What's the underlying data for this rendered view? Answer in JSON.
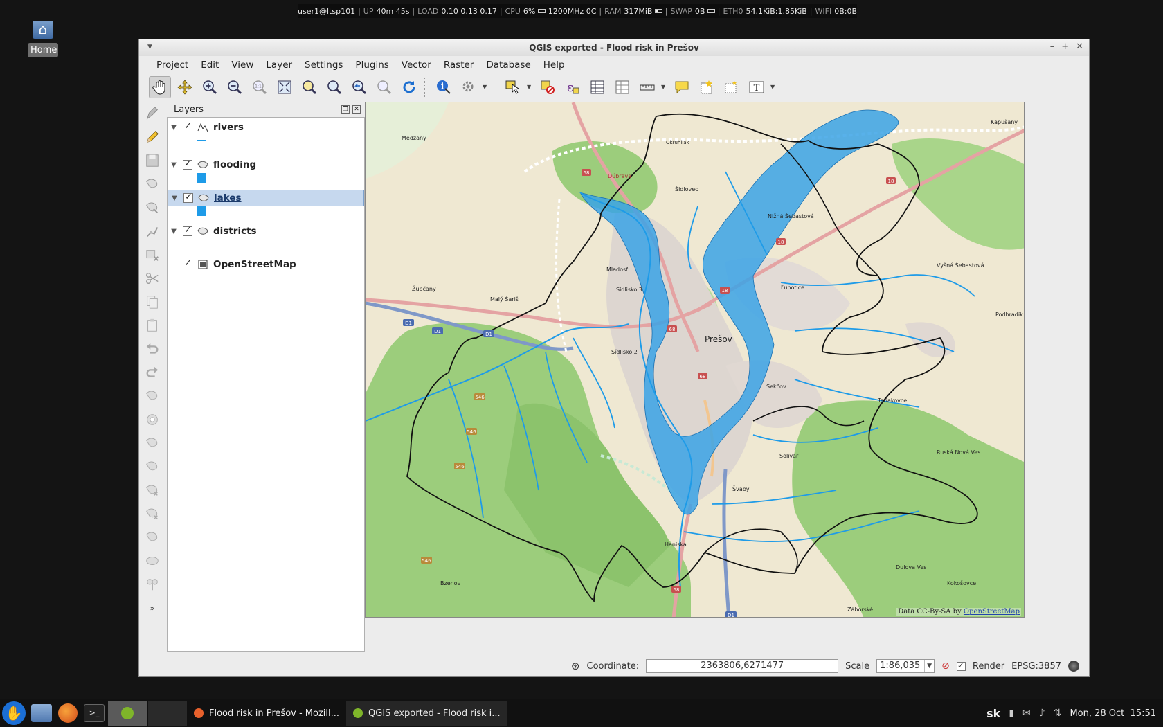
{
  "sysbar": {
    "user": "user1@ltsp101",
    "up_label": "UP",
    "up_value": "40m 45s",
    "load_label": "LOAD",
    "load_value": "0.10 0.13 0.17",
    "cpu_label": "CPU",
    "cpu_value": "6%",
    "cpu_level": 0.06,
    "cpu_freq": "1200MHz 0C",
    "ram_label": "RAM",
    "ram_value": "317MiB",
    "ram_level": 0.32,
    "swap_label": "SWAP",
    "swap_value": "0B",
    "swap_level": 0.0,
    "eth_label": "ETH0",
    "eth_value": "54.1KiB:1.85KiB",
    "wifi_label": "WIFI",
    "wifi_value": "0B:0B"
  },
  "desktop": {
    "home_label": "Home"
  },
  "window": {
    "title": "QGIS exported - Flood risk in Prešov",
    "menu": [
      "Project",
      "Edit",
      "View",
      "Layer",
      "Settings",
      "Plugins",
      "Vector",
      "Raster",
      "Database",
      "Help"
    ]
  },
  "layers_panel": {
    "title": "Layers",
    "layers": [
      {
        "name": "rivers",
        "visible": true,
        "type": "line",
        "color": "#1e9be8"
      },
      {
        "name": "flooding",
        "visible": true,
        "type": "polygon",
        "color": "#1e9be8"
      },
      {
        "name": "lakes",
        "visible": true,
        "type": "polygon",
        "color": "#1e9be8",
        "selected": true
      },
      {
        "name": "districts",
        "visible": true,
        "type": "polygon",
        "color": "#ffffff"
      },
      {
        "name": "OpenStreetMap",
        "visible": true,
        "type": "raster"
      }
    ]
  },
  "map": {
    "attribution_prefix": "Data CC-By-SA by ",
    "attribution_link": "OpenStreetMap",
    "labels": {
      "presov": "Prešov",
      "sidlisko2": "Sídlisko 2",
      "sidlisko3": "Sídlisko 3",
      "mladost": "Mladosť",
      "sidlovec": "Šidlovec",
      "niznaSebastova": "Nižná Šebastová",
      "vysnaSebastova": "Vyšná Šebastová",
      "solivar": "Solivar",
      "svaby": "Švaby",
      "sekcov": "Sekčov",
      "medzany": "Medzany",
      "zupcany": "Župčany",
      "malySaris": "Malý Šariš",
      "haniska": "Haniska",
      "ruskaNovaVes": "Ruská Nová Ves",
      "terniakovce": "Teriakovce",
      "podhradik": "Podhradík",
      "dulovaVes": "Dulova Ves",
      "kokosovce": "Kokošovce",
      "zaborske": "Záborské",
      "bzenov": "Bzenov",
      "kapusany": "Kapušany",
      "lubotice": "Ľubotice",
      "okruhliak": "Okruhliak",
      "dubrava": "Dúbrava",
      "roads": {
        "r68a": "68",
        "r68b": "68",
        "r68c": "68",
        "r68d": "68",
        "r18a": "18",
        "r18b": "18",
        "r18c": "18",
        "d1a": "D1",
        "d1b": "D1",
        "d1c": "D1",
        "d1d": "D1",
        "r546a": "546",
        "r546b": "546",
        "r546c": "546",
        "r546d": "546"
      }
    }
  },
  "statusbar": {
    "coordinate_label": "Coordinate:",
    "coordinate_value": "2363806,6271477",
    "scale_label": "Scale",
    "scale_value": "1:86,035",
    "render_label": "Render",
    "crs": "EPSG:3857"
  },
  "taskbar": {
    "tasks": [
      {
        "label": "Flood risk in Prešov - Mozill...",
        "color": "#e8612c"
      },
      {
        "label": "QGIS exported - Flood risk i...",
        "color": "#7fb52a"
      }
    ],
    "lang": "sk",
    "clock": "Mon, 28 Oct  15:51"
  },
  "colors": {
    "accent_water": "#1e9be8",
    "flood_fill": "#3ba3e6",
    "district_line": "#000000",
    "forest": "#8cc56c",
    "farmland": "#e8dfc8"
  }
}
